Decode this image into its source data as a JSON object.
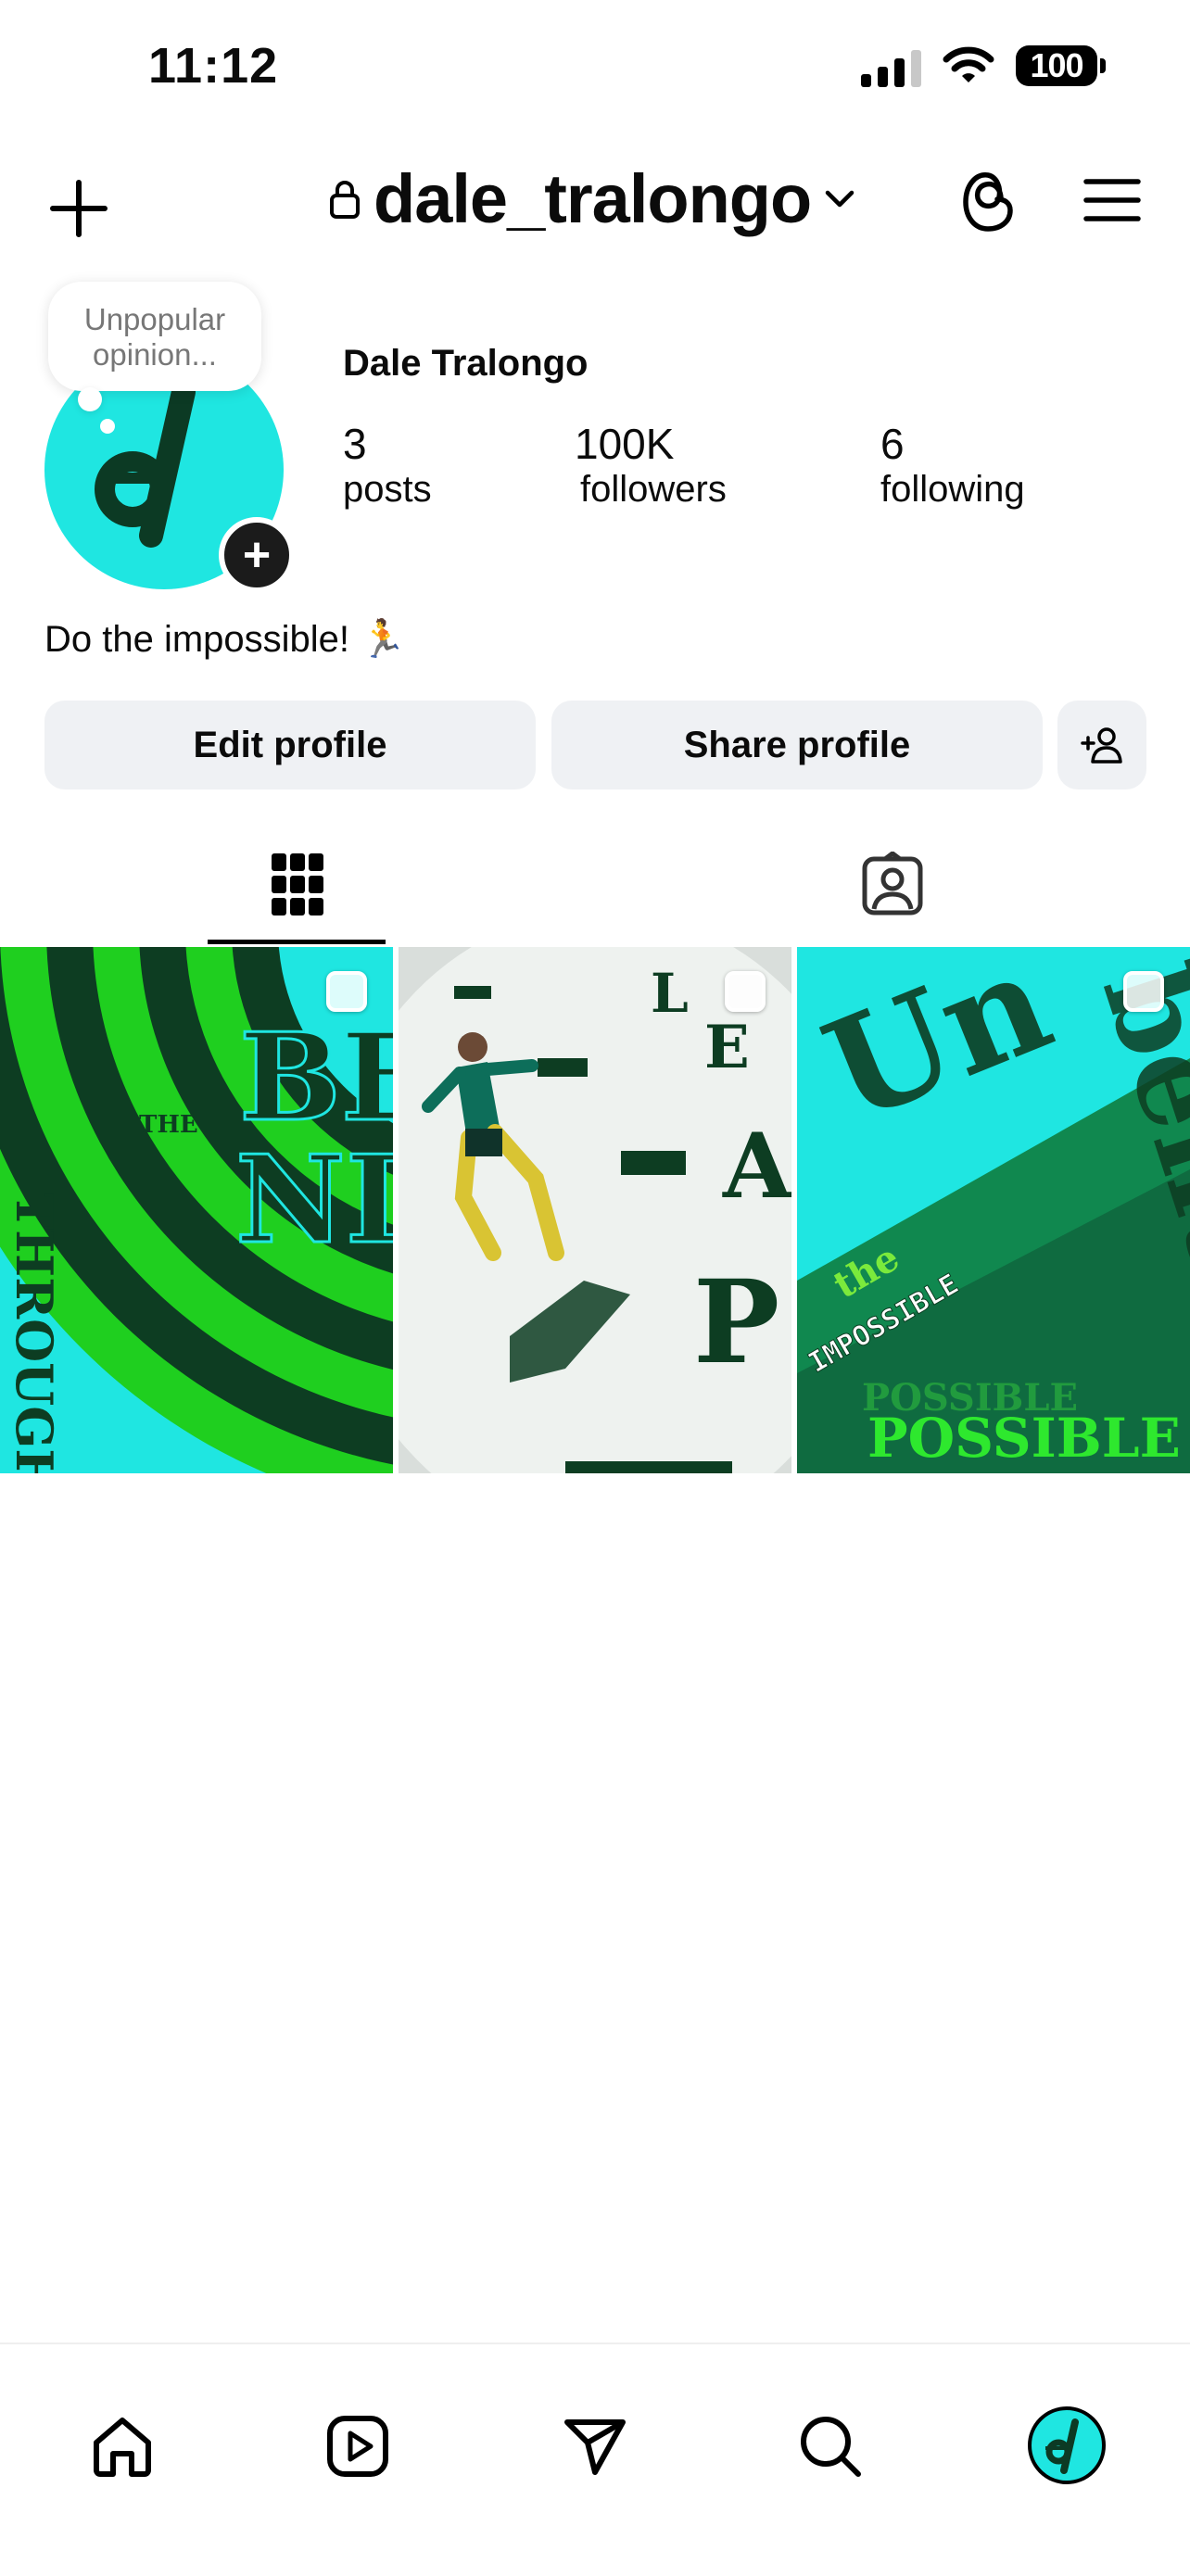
{
  "status_bar": {
    "time": "11:12",
    "battery": "100"
  },
  "header": {
    "username": "dale_tralongo"
  },
  "profile": {
    "note": "Unpopular opinion...",
    "full_name": "Dale Tralongo",
    "stats": [
      {
        "value": "3",
        "label": "posts"
      },
      {
        "value": "100K",
        "label": "followers"
      },
      {
        "value": "6",
        "label": "following"
      }
    ],
    "bio": "Do the impossible! 🏃"
  },
  "actions": {
    "edit": "Edit profile",
    "share": "Share profile"
  },
  "posts": [
    {
      "words": [
        "THE",
        "BE",
        "ND",
        "THROUGH"
      ]
    },
    {
      "words": [
        "L",
        "E",
        "A",
        "P"
      ]
    },
    {
      "words": [
        "the",
        "IMPOSSIBLE",
        "POSSIBLE"
      ]
    }
  ],
  "colors": {
    "accent": "#1fe6e1",
    "green": "#1fcf1f",
    "dark_green": "#0d3d22"
  },
  "icons": [
    "plus-icon",
    "lock-icon",
    "chevron-down-icon",
    "threads-icon",
    "menu-icon",
    "grid-icon",
    "tagged-icon",
    "home-icon",
    "reels-icon",
    "send-icon",
    "search-icon"
  ]
}
